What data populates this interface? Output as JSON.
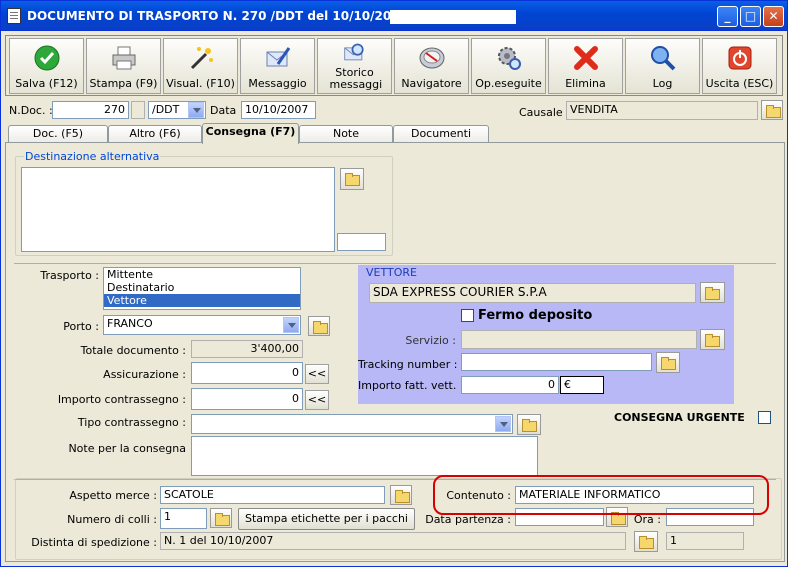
{
  "window": {
    "title": "DOCUMENTO DI TRASPORTO N. 270 /DDT del 10/10/2007 -"
  },
  "toolbar": {
    "buttons": [
      {
        "label": "Salva (F12)",
        "icon": "check-icon"
      },
      {
        "label": "Stampa (F9)",
        "icon": "printer-icon"
      },
      {
        "label": "Visual. (F10)",
        "icon": "magic-wand-icon"
      },
      {
        "label": "Messaggio",
        "icon": "envelope-pen-icon"
      },
      {
        "label": "Storico messaggi",
        "icon": "envelope-search-icon"
      },
      {
        "label": "Navigatore",
        "icon": "compass-icon"
      },
      {
        "label": "Op.eseguite",
        "icon": "gears-search-icon"
      },
      {
        "label": "Elimina",
        "icon": "red-x-icon"
      },
      {
        "label": "Log",
        "icon": "log-search-icon"
      },
      {
        "label": "Uscita (ESC)",
        "icon": "exit-icon"
      }
    ]
  },
  "header": {
    "ndoc_label": "N.Doc. :",
    "ndoc_value": "270",
    "series_value": "/DDT",
    "data_label": "Data :",
    "data_value": "10/10/2007",
    "causale_label": "Causale :",
    "causale_value": "VENDITA"
  },
  "tabs": [
    {
      "label": "Doc. (F5)",
      "active": false
    },
    {
      "label": "Altro (F6)",
      "active": false
    },
    {
      "label": "Consegna (F7)",
      "active": true
    },
    {
      "label": "Note",
      "active": false
    },
    {
      "label": "Documenti",
      "active": false
    }
  ],
  "destinazione": {
    "title": "Destinazione alternativa",
    "text": "",
    "code": ""
  },
  "trasporto": {
    "label": "Trasporto :",
    "options": [
      "Mittente",
      "Destinatario",
      "Vettore"
    ],
    "selected": "Vettore"
  },
  "porto": {
    "label": "Porto :",
    "value": "FRANCO"
  },
  "totale": {
    "label": "Totale documento :",
    "value": "3'400,00"
  },
  "assicurazione": {
    "label": "Assicurazione :",
    "value": "0",
    "btn": "<<"
  },
  "contrassegno": {
    "label": "Importo contrassegno :",
    "value": "0",
    "btn": "<<"
  },
  "tipo_contrassegno": {
    "label": "Tipo contrassegno :",
    "value": ""
  },
  "note_consegna": {
    "label": "Note per la consegna",
    "value": ""
  },
  "vettore": {
    "title": "VETTORE",
    "name": "SDA EXPRESS COURIER S.P.A",
    "fermo_label": "Fermo deposito",
    "servizio_label": "Servizio :",
    "servizio_value": "",
    "tracking_label": "Tracking number :",
    "tracking_value": "",
    "importo_label": "Importo fatt. vett. :",
    "importo_value": "0",
    "currency": "€"
  },
  "urgente": {
    "label": "CONSEGNA URGENTE"
  },
  "bottom": {
    "aspetto_label": "Aspetto merce :",
    "aspetto_value": "SCATOLE",
    "contenuto_label": "Contenuto :",
    "contenuto_value": "MATERIALE INFORMATICO",
    "colli_label": "Numero di colli :",
    "colli_value": "1",
    "stampa_label": "Stampa etichette per i pacchi",
    "partenza_label": "Data partenza :",
    "partenza_value": "",
    "ora_label": "Ora :",
    "ora_value": "",
    "distinta_label": "Distinta di spedizione :",
    "distinta_value": "N. 1 del 10/10/2007",
    "distinta_num": "1"
  },
  "colors": {
    "titlebar": "#0045d4",
    "vettore_bg": "#b7b8f5",
    "highlight": "#d80000",
    "group_label": "#0046d5"
  }
}
